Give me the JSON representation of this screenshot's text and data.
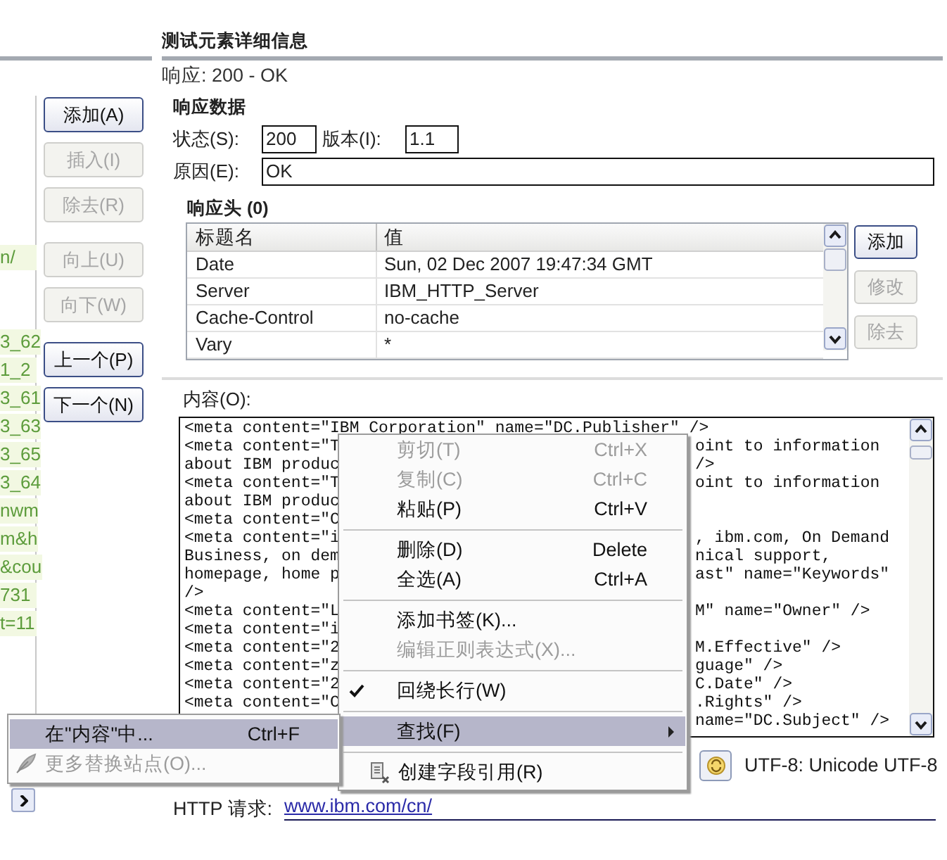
{
  "left_pane": {
    "list_items": [
      "n/",
      "3_62",
      "1_2",
      "3_61",
      "3_63",
      "3_65",
      "3_64",
      "nwm",
      "m&h",
      "&cou",
      "731",
      "t=11"
    ],
    "button_groups": [
      [
        {
          "label": "添加(A)",
          "disabled": false
        },
        {
          "label": "插入(I)",
          "disabled": true
        },
        {
          "label": "除去(R)",
          "disabled": true
        }
      ],
      [
        {
          "label": "向上(U)",
          "disabled": true
        },
        {
          "label": "向下(W)",
          "disabled": true
        }
      ],
      [
        {
          "label": "上一个(P)",
          "disabled": false
        },
        {
          "label": "下一个(N)",
          "disabled": false
        }
      ]
    ]
  },
  "details": {
    "title": "测试元素详细信息",
    "response": "响应: 200 - OK",
    "response_data": {
      "heading": "响应数据",
      "status_label": "状态(S):",
      "status": "200",
      "version_label": "版本(I):",
      "version": "1.1",
      "reason_label": "原因(E):",
      "reason": "OK"
    },
    "headers": {
      "heading": "响应头 (0)",
      "columns": [
        "标题名",
        "值"
      ],
      "rows": [
        [
          "Date",
          "Sun, 02 Dec 2007 19:47:34 GMT"
        ],
        [
          "Server",
          "IBM_HTTP_Server"
        ],
        [
          "Cache-Control",
          "no-cache"
        ],
        [
          "Vary",
          "*"
        ]
      ],
      "buttons": [
        {
          "label": "添加",
          "disabled": false
        },
        {
          "label": "修改",
          "disabled": true
        },
        {
          "label": "除去",
          "disabled": true
        }
      ]
    },
    "content": {
      "label": "内容(O):",
      "lines": [
        {
          "left": "<meta content=\"IBM Corporation\" name=\"DC.Publisher\" />"
        },
        {
          "left": "<meta content=\"T",
          "right": "oint to information"
        },
        {
          "left": "about IBM produc",
          "right": "/>"
        },
        {
          "left": "<meta content=\"T",
          "right": "oint to information"
        },
        {
          "left": "about IBM produc"
        },
        {
          "left": "<meta content=\"C"
        },
        {
          "left": "<meta content=\"i",
          "right": ", ibm.com, On Demand"
        },
        {
          "left": "Business, on dem",
          "right": "nical support,"
        },
        {
          "left": "homepage, home p",
          "right": "ast\" name=\"Keywords\""
        },
        {
          "left": "/>"
        },
        {
          "left": "<meta content=\"L",
          "right": "M\" name=\"Owner\" />"
        },
        {
          "left": "<meta content=\"i"
        },
        {
          "left": "<meta content=\"2",
          "right": "M.Effective\" />"
        },
        {
          "left": "<meta content=\"z",
          "right": "guage\" />"
        },
        {
          "left": "<meta content=\"2",
          "right": "C.Date\" />"
        },
        {
          "left": "<meta content=\"C",
          "right": ".Rights\" />"
        },
        {
          "right": "name=\"DC.Subject\" />"
        }
      ]
    },
    "encoding": "UTF-8: Unicode UTF-8",
    "http_request": {
      "label": "HTTP 请求:",
      "link": "www.ibm.com/cn/"
    }
  },
  "context_menu": {
    "items": [
      {
        "kind": "item",
        "label": "剪切(T)",
        "shortcut": "Ctrl+X",
        "disabled": true,
        "selected": false
      },
      {
        "kind": "item",
        "label": "复制(C)",
        "shortcut": "Ctrl+C",
        "disabled": true,
        "selected": false
      },
      {
        "kind": "item",
        "label": "粘贴(P)",
        "shortcut": "Ctrl+V",
        "disabled": false,
        "selected": false
      },
      {
        "kind": "separator"
      },
      {
        "kind": "item",
        "label": "删除(D)",
        "shortcut": "Delete",
        "disabled": false,
        "selected": false
      },
      {
        "kind": "item",
        "label": "全选(A)",
        "shortcut": "Ctrl+A",
        "disabled": false,
        "selected": false
      },
      {
        "kind": "separator"
      },
      {
        "kind": "item",
        "label": "添加书签(K)...",
        "disabled": false,
        "selected": false
      },
      {
        "kind": "item",
        "label": "编辑正则表达式(X)...",
        "disabled": true,
        "selected": false
      },
      {
        "kind": "separator"
      },
      {
        "kind": "check",
        "label": "回绕长行(W)",
        "checked": true,
        "disabled": false,
        "selected": false
      },
      {
        "kind": "separator"
      },
      {
        "kind": "submenu",
        "label": "查找(F)",
        "disabled": false,
        "selected": true
      },
      {
        "kind": "separator"
      },
      {
        "kind": "icon",
        "label": "创建字段引用(R)",
        "disabled": false,
        "selected": false
      }
    ]
  },
  "submenu": {
    "items": [
      {
        "kind": "item",
        "label": "在\"内容\"中...",
        "shortcut": "Ctrl+F",
        "disabled": false,
        "selected": true
      },
      {
        "kind": "feather",
        "label": "更多替换站点(O)...",
        "disabled": true,
        "selected": false
      }
    ]
  }
}
